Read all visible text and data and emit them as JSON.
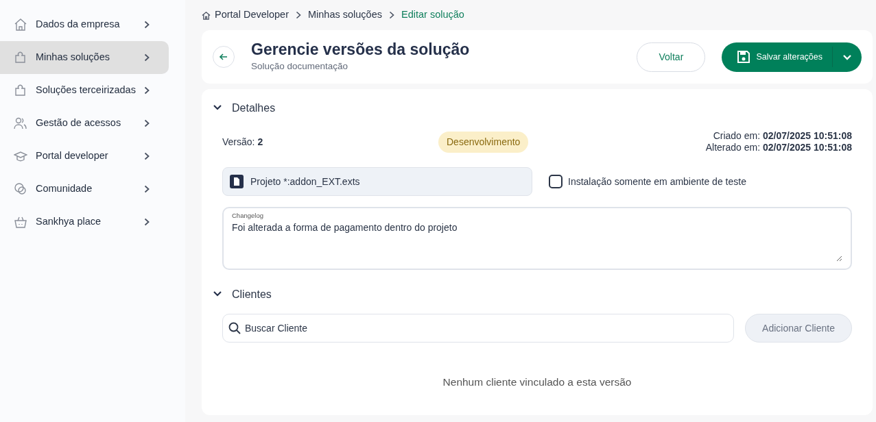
{
  "sidebar": {
    "items": [
      {
        "label": "Dados da empresa",
        "selected": false
      },
      {
        "label": "Minhas soluções",
        "selected": true
      },
      {
        "label": "Soluções terceirizadas",
        "selected": false
      },
      {
        "label": "Gestão de acessos",
        "selected": false
      },
      {
        "label": "Portal developer",
        "selected": false
      },
      {
        "label": "Comunidade",
        "selected": false
      },
      {
        "label": "Sankhya place",
        "selected": false
      }
    ]
  },
  "breadcrumb": [
    {
      "label": "Portal Developer",
      "current": false
    },
    {
      "label": "Minhas soluções",
      "current": false
    },
    {
      "label": "Editar solução",
      "current": true
    }
  ],
  "header": {
    "title": "Gerencie versões da solução",
    "subtitle": "Solução documentação",
    "back_button": "Voltar",
    "save_button": "Salvar alterações"
  },
  "details": {
    "heading": "Detalhes",
    "expanded": true,
    "version": "Versão: **2**",
    "status": "Desenvolvimento",
    "created": "Criado em: **02/07/2025 10:51:08**",
    "modified": "Alterado em: **02/07/2025 10:51:08**",
    "file": "Projeto *:addon_EXT.exts",
    "test_only": {
      "label": "Instalação somente em ambiente de teste",
      "checked": false
    },
    "changelog": {
      "label": "Changelog",
      "value": "Foi alterada a forma de pagamento dentro do projeto"
    }
  },
  "clients": {
    "heading": "Clientes",
    "expanded": true,
    "search": {
      "placeholder": "Buscar Cliente"
    },
    "add_button": {
      "label": "Adicionar Cliente",
      "disabled": true
    },
    "empty_message": "Nenhum cliente vinculado a esta versão"
  }
}
